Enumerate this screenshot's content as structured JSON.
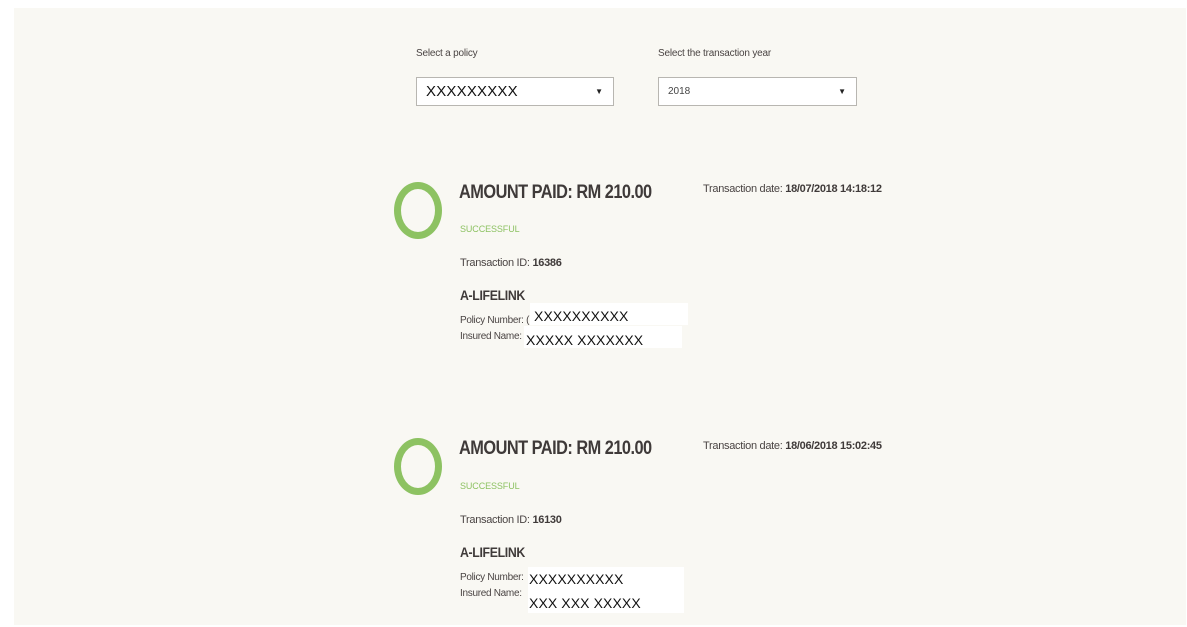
{
  "filters": {
    "policy_label": "Select a policy",
    "policy_value": "XXXXXXXXX",
    "year_label": "Select the transaction year",
    "year_value": "2018"
  },
  "colors": {
    "accent_green": "#8dc262",
    "text_dark": "#3f3a39"
  },
  "transactions": [
    {
      "amount_text": "AMOUNT PAID: RM 210.00",
      "status": "SUCCESSFUL",
      "date_label": "Transaction date:",
      "date_value": "18/07/2018 14:18:12",
      "id_label": "Transaction ID:",
      "id_value": "16386",
      "product": "A-LIFELINK",
      "policy_number_label": "Policy Number: (",
      "policy_number_value": "XXXXXXXXXX",
      "insured_name_label": "Insured Name:",
      "insured_name_value": "XXXXX XXXXXXX"
    },
    {
      "amount_text": "AMOUNT PAID: RM 210.00",
      "status": "SUCCESSFUL",
      "date_label": "Transaction date:",
      "date_value": "18/06/2018 15:02:45",
      "id_label": "Transaction ID:",
      "id_value": "16130",
      "product": "A-LIFELINK",
      "policy_number_label": "Policy Number:",
      "policy_number_value": "XXXXXXXXXX",
      "insured_name_label": "Insured Name:",
      "insured_name_value": "XXX XXX XXXXX"
    }
  ]
}
